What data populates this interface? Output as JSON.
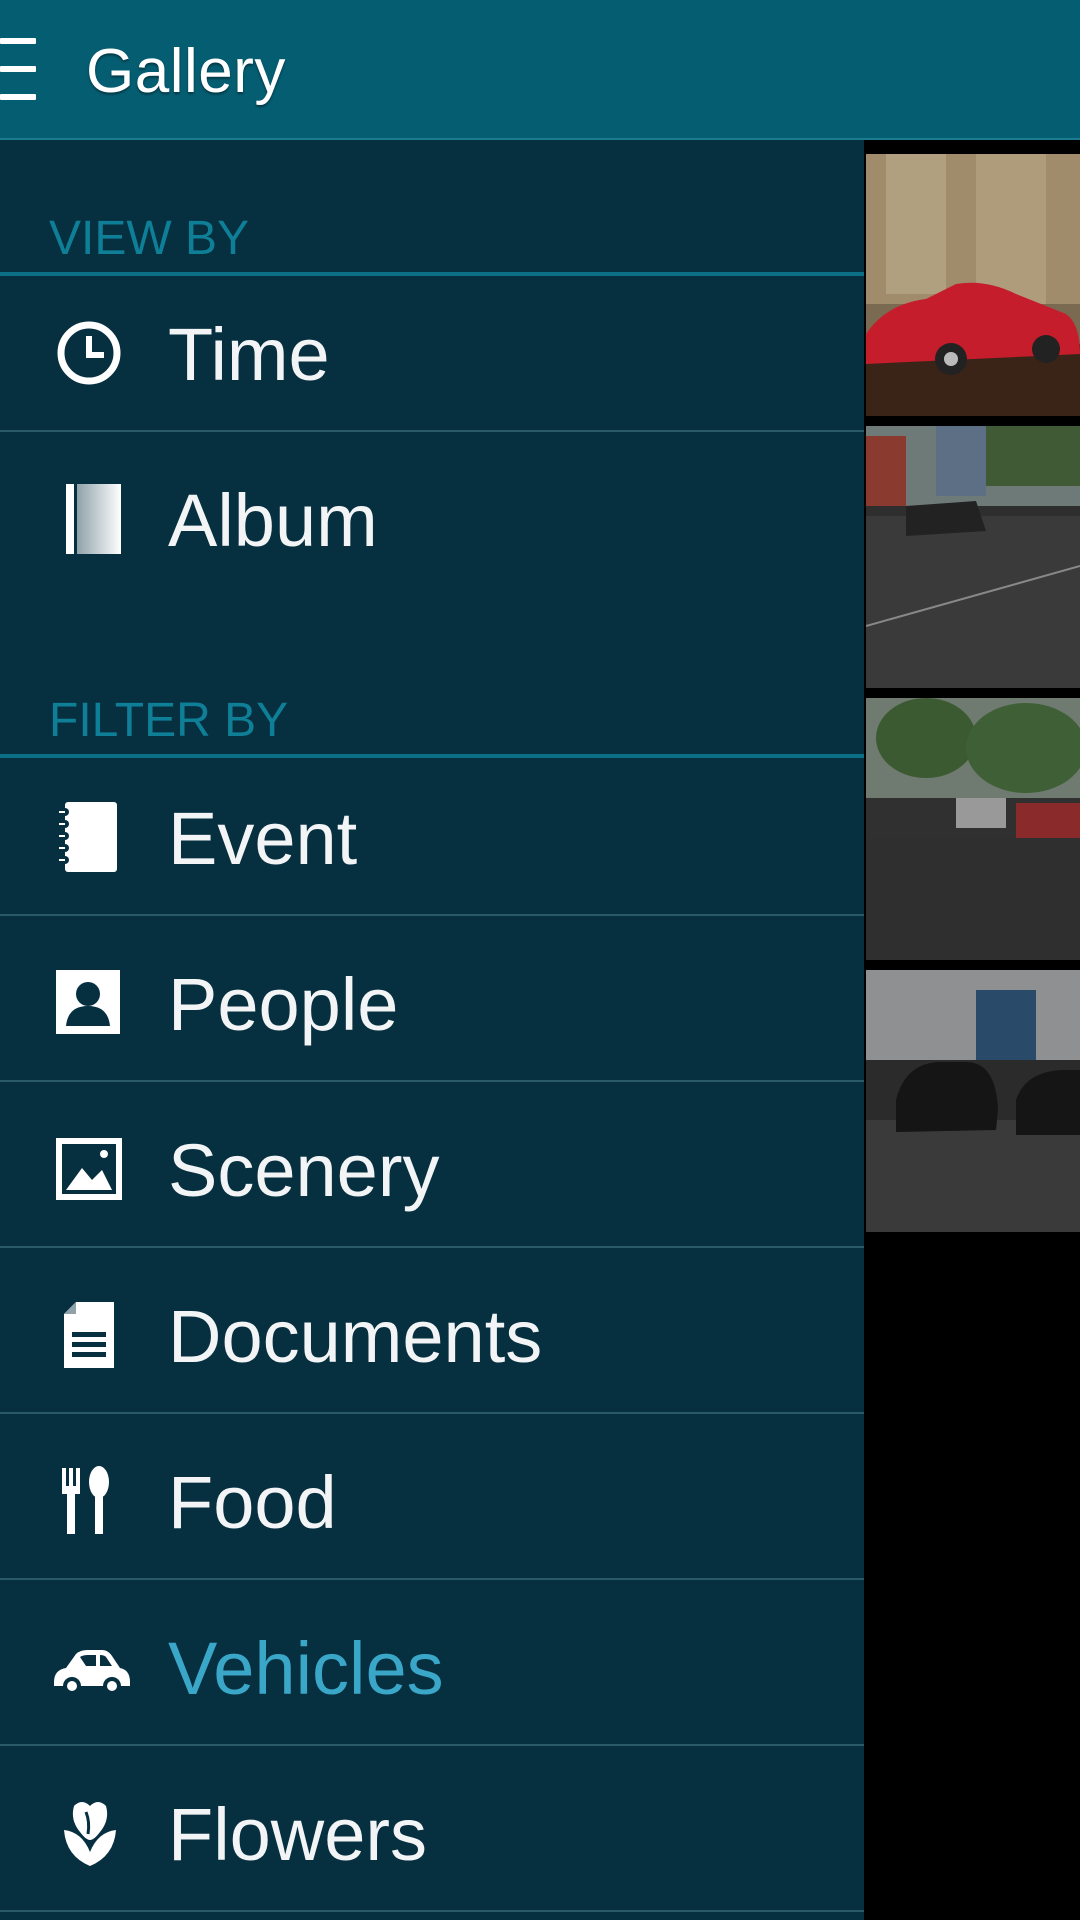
{
  "app_bar": {
    "title": "Gallery",
    "menu_icon": "hamburger-menu-icon"
  },
  "drawer": {
    "view_by": {
      "header": "VIEW BY",
      "items": [
        {
          "label": "Time",
          "icon": "clock-icon"
        },
        {
          "label": "Album",
          "icon": "album-book-icon"
        }
      ]
    },
    "filter_by": {
      "header": "FILTER BY",
      "items": [
        {
          "label": "Event",
          "icon": "notebook-icon"
        },
        {
          "label": "People",
          "icon": "person-icon"
        },
        {
          "label": "Scenery",
          "icon": "landscape-icon"
        },
        {
          "label": "Documents",
          "icon": "document-icon"
        },
        {
          "label": "Food",
          "icon": "fork-spoon-icon"
        },
        {
          "label": "Vehicles",
          "icon": "car-icon",
          "selected": true
        },
        {
          "label": "Flowers",
          "icon": "flower-icon"
        }
      ]
    }
  },
  "thumbnails": [
    "red toy car photo",
    "wet street photo",
    "parked cars street photo",
    "parking lot photo"
  ],
  "colors": {
    "app_bar": "#055d71",
    "drawer": "#062f40",
    "section_header": "#0e7f97",
    "selected_item": "#3aa6c8"
  }
}
